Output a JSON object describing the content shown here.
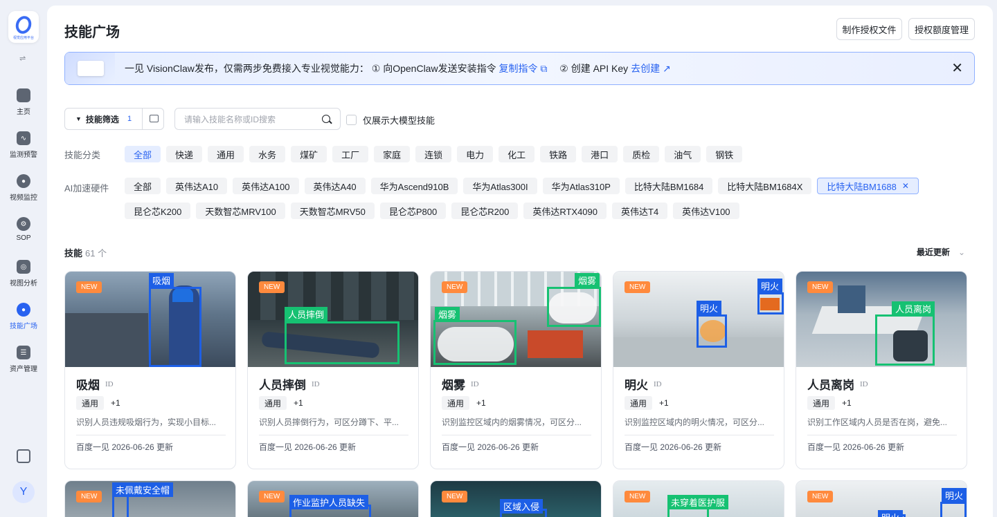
{
  "sidebar": {
    "logo_text": "视觉应用平台",
    "collapse_icon": "⇌",
    "items": [
      {
        "label": "主页",
        "icon": "home-icon",
        "active": false
      },
      {
        "label": "监测预警",
        "icon": "chart-icon",
        "active": false
      },
      {
        "label": "视频监控",
        "icon": "camera-icon",
        "active": false
      },
      {
        "label": "SOP",
        "icon": "sop-icon",
        "active": false
      },
      {
        "label": "视图分析",
        "icon": "image-analysis-icon",
        "active": false
      },
      {
        "label": "技能广场",
        "icon": "skills-icon",
        "active": true
      },
      {
        "label": "资产管理",
        "icon": "asset-icon",
        "active": false
      }
    ],
    "avatar": "Y"
  },
  "header": {
    "title": "技能广场",
    "btn_auth_file": "制作授权文件",
    "btn_quota": "授权额度管理"
  },
  "banner": {
    "text": "一见 VisionClaw发布，仅需两步免费接入专业视觉能力： ① 向OpenClaw发送安装指令",
    "copy_link": "复制指令",
    "step2": "② 创建 API Key",
    "create_link": "去创建"
  },
  "filters": {
    "filter_label": "技能筛选",
    "filter_count": "1",
    "search_placeholder": "请输入技能名称或ID搜索",
    "checkbox_label": "仅展示大模型技能",
    "category_label": "技能分类",
    "categories": [
      "全部",
      "快递",
      "通用",
      "水务",
      "煤矿",
      "工厂",
      "家庭",
      "连锁",
      "电力",
      "化工",
      "铁路",
      "港口",
      "质检",
      "油气",
      "钢铁"
    ],
    "hardware_label": "AI加速硬件",
    "hardware": [
      "全部",
      "英伟达A10",
      "英伟达A100",
      "英伟达A40",
      "华为Ascend910B",
      "华为Atlas300I",
      "华为Atlas310P",
      "比特大陆BM1684",
      "比特大陆BM1684X",
      "比特大陆BM1688",
      "昆仑芯K200",
      "天数智芯MRV100",
      "天数智芯MRV50",
      "昆仑芯P800",
      "昆仑芯R200",
      "英伟达RTX4090",
      "英伟达T4",
      "英伟达V100"
    ],
    "hardware_selected": "比特大陆BM1688"
  },
  "list": {
    "count_label": "技能",
    "count": "61 个",
    "sort_label": "最近更新"
  },
  "colors": {
    "accent": "#2862f0",
    "new_badge": "#ff8a3d",
    "box_blue": "#1d5fe6",
    "box_green": "#16c172"
  },
  "cards": [
    {
      "title": "吸烟",
      "id": "ID",
      "badge": "NEW",
      "tag": "通用",
      "tag_more": "+1",
      "desc": "识别人员违规吸烟行为，实现小目标...",
      "meta": "百度一见 2026-06-26 更新",
      "labels": [
        "吸烟"
      ]
    },
    {
      "title": "人员摔倒",
      "id": "ID",
      "badge": "NEW",
      "tag": "通用",
      "tag_more": "+1",
      "desc": "识别人员摔倒行为，可区分蹲下、平...",
      "meta": "百度一见 2026-06-26 更新",
      "labels": [
        "人员摔倒"
      ]
    },
    {
      "title": "烟雾",
      "id": "ID",
      "badge": "NEW",
      "tag": "通用",
      "tag_more": "+1",
      "desc": "识别监控区域内的烟雾情况，可区分...",
      "meta": "百度一见 2026-06-26 更新",
      "labels": [
        "烟雾",
        "烟雾"
      ]
    },
    {
      "title": "明火",
      "id": "ID",
      "badge": "NEW",
      "tag": "通用",
      "tag_more": "+1",
      "desc": "识别监控区域内的明火情况，可区分...",
      "meta": "百度一见 2026-06-26 更新",
      "labels": [
        "明火",
        "明火"
      ]
    },
    {
      "title": "人员离岗",
      "id": "ID",
      "badge": "NEW",
      "tag": "通用",
      "tag_more": "+1",
      "desc": "识别工作区域内人员是否在岗，避免...",
      "meta": "百度一见 2026-06-26 更新",
      "labels": [
        "人员离岗"
      ]
    },
    {
      "badge": "NEW",
      "labels": [
        "未佩戴安全帽"
      ]
    },
    {
      "badge": "NEW",
      "labels": [
        "作业监护人员缺失"
      ]
    },
    {
      "badge": "NEW",
      "labels": [
        "区域入侵"
      ]
    },
    {
      "badge": "NEW",
      "labels": [
        "未穿着医护服"
      ]
    },
    {
      "badge": "NEW",
      "labels": [
        "明火",
        "明火"
      ]
    }
  ]
}
